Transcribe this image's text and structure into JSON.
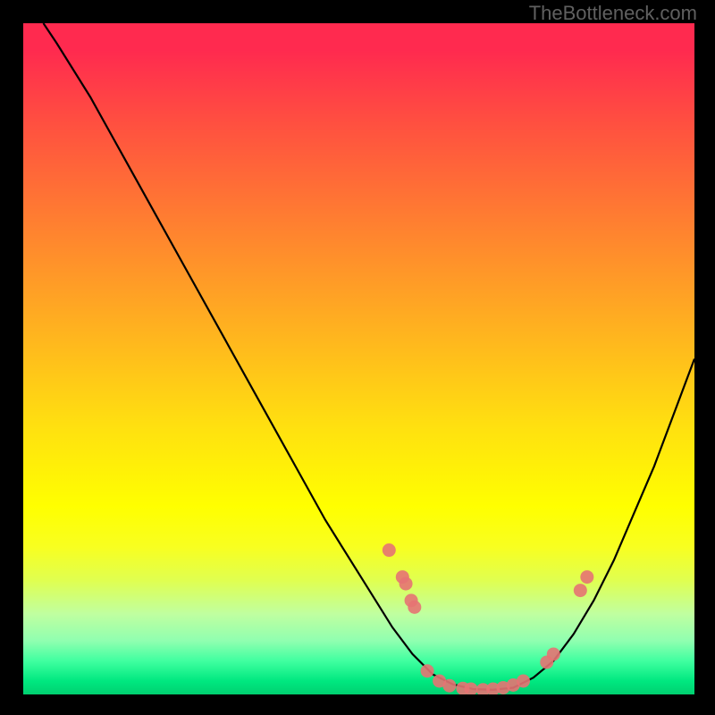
{
  "watermark": "TheBottleneck.com",
  "chart_data": {
    "type": "line",
    "title": "",
    "xlabel": "",
    "ylabel": "",
    "xlim": [
      0,
      100
    ],
    "ylim": [
      0,
      100
    ],
    "curve": [
      {
        "x": 3,
        "y": 100
      },
      {
        "x": 5,
        "y": 97
      },
      {
        "x": 10,
        "y": 89
      },
      {
        "x": 15,
        "y": 80
      },
      {
        "x": 20,
        "y": 71
      },
      {
        "x": 25,
        "y": 62
      },
      {
        "x": 30,
        "y": 53
      },
      {
        "x": 35,
        "y": 44
      },
      {
        "x": 40,
        "y": 35
      },
      {
        "x": 45,
        "y": 26
      },
      {
        "x": 50,
        "y": 18
      },
      {
        "x": 55,
        "y": 10
      },
      {
        "x": 58,
        "y": 6
      },
      {
        "x": 61,
        "y": 3
      },
      {
        "x": 64,
        "y": 1.5
      },
      {
        "x": 67,
        "y": 0.8
      },
      {
        "x": 70,
        "y": 0.7
      },
      {
        "x": 73,
        "y": 1.0
      },
      {
        "x": 76,
        "y": 2.5
      },
      {
        "x": 79,
        "y": 5
      },
      {
        "x": 82,
        "y": 9
      },
      {
        "x": 85,
        "y": 14
      },
      {
        "x": 88,
        "y": 20
      },
      {
        "x": 91,
        "y": 27
      },
      {
        "x": 94,
        "y": 34
      },
      {
        "x": 97,
        "y": 42
      },
      {
        "x": 100,
        "y": 50
      }
    ],
    "markers": [
      {
        "x": 54.5,
        "y": 21.5
      },
      {
        "x": 56.5,
        "y": 17.5
      },
      {
        "x": 57.0,
        "y": 16.5
      },
      {
        "x": 57.8,
        "y": 14
      },
      {
        "x": 58.3,
        "y": 13
      },
      {
        "x": 60.2,
        "y": 3.5
      },
      {
        "x": 62.0,
        "y": 2.0
      },
      {
        "x": 63.5,
        "y": 1.3
      },
      {
        "x": 65.5,
        "y": 0.9
      },
      {
        "x": 66.7,
        "y": 0.8
      },
      {
        "x": 68.5,
        "y": 0.7
      },
      {
        "x": 70.0,
        "y": 0.8
      },
      {
        "x": 71.5,
        "y": 1.0
      },
      {
        "x": 73.0,
        "y": 1.4
      },
      {
        "x": 74.5,
        "y": 2.0
      },
      {
        "x": 78.0,
        "y": 4.8
      },
      {
        "x": 79.0,
        "y": 6.0
      },
      {
        "x": 83.0,
        "y": 15.5
      },
      {
        "x": 84.0,
        "y": 17.5
      }
    ],
    "marker_color": "#e57373",
    "background": "red-yellow-green vertical gradient"
  }
}
